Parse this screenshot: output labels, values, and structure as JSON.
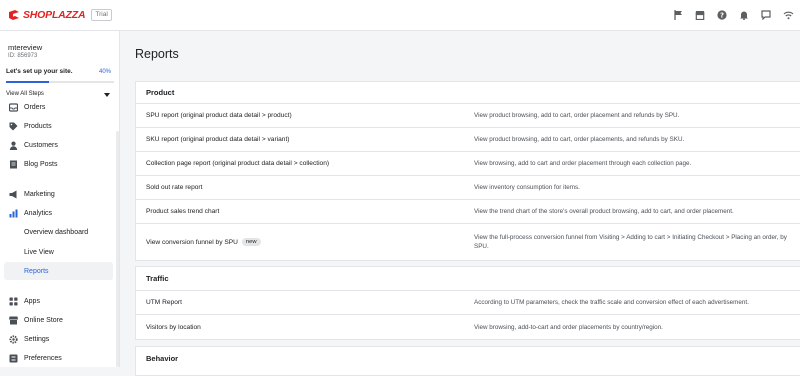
{
  "topbar": {
    "brand": "SHOPLAZZA",
    "trial_label": "Trial",
    "icons": [
      "flag-icon",
      "store-icon",
      "help-icon",
      "bell-icon",
      "chat-icon",
      "wifi-icon"
    ]
  },
  "sidebar": {
    "store_name": "mtereview",
    "store_id": "ID: 856973",
    "setup_label": "Let's set up your site.",
    "setup_percent": "40%",
    "setup_progress": 0.4,
    "view_steps": "View All Steps",
    "items": [
      {
        "label": "Orders",
        "icon": "orders-icon"
      },
      {
        "label": "Products",
        "icon": "tag-icon"
      },
      {
        "label": "Customers",
        "icon": "person-icon"
      },
      {
        "label": "Blog Posts",
        "icon": "document-icon"
      },
      {
        "label": "Marketing",
        "icon": "megaphone-icon"
      },
      {
        "label": "Analytics",
        "icon": "bar-chart-icon"
      },
      {
        "label": "Overview dashboard"
      },
      {
        "label": "Live View"
      },
      {
        "label": "Reports"
      },
      {
        "label": "Apps",
        "icon": "apps-icon"
      },
      {
        "label": "Online Store",
        "icon": "store-icon"
      },
      {
        "label": "Settings",
        "icon": "gear-icon"
      },
      {
        "label": "Preferences",
        "icon": "preferences-icon"
      }
    ]
  },
  "main": {
    "title": "Reports",
    "sections": [
      {
        "title": "Product",
        "rows": [
          {
            "name": "SPU report  (original product data detail > product)",
            "desc": "View product browsing, add to cart, order placement and refunds by SPU."
          },
          {
            "name": "SKU report  (original product data detail > variant)",
            "desc": "View product browsing, add to cart, order placements, and refunds by SKU."
          },
          {
            "name": "Collection page report (original product data detail > collection)",
            "desc": "View browsing, add to cart and order placement through each collection page."
          },
          {
            "name": "Sold out rate report",
            "desc": "View inventory consumption for items."
          },
          {
            "name": "Product sales trend chart",
            "desc": "View the trend chart of the store's overall product browsing, add to cart, and order placement."
          },
          {
            "name": "View conversion funnel by SPU",
            "badge": "new",
            "desc": "View the full-process conversion funnel from Visiting > Adding to cart > Initiating Checkout > Placing an order, by SPU."
          }
        ]
      },
      {
        "title": "Traffic",
        "rows": [
          {
            "name": "UTM Report",
            "desc": "According to UTM parameters, check the traffic scale and conversion effect of each advertisement."
          },
          {
            "name": "Visitors by location",
            "desc": "View browsing, add-to-cart and order placements by country/region."
          }
        ]
      },
      {
        "title": "Behavior",
        "rows": []
      }
    ]
  },
  "colors": {
    "brand": "#e02424",
    "accent": "#2b63d9"
  }
}
